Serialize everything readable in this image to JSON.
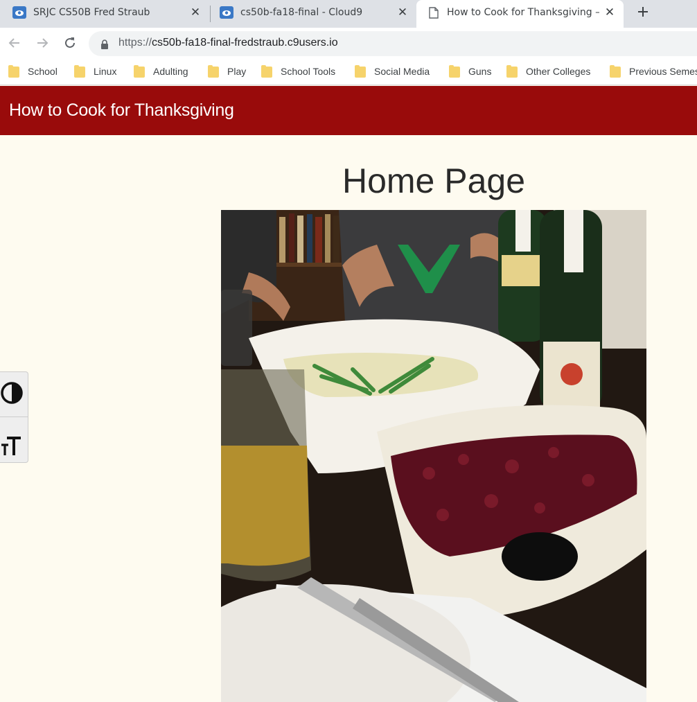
{
  "browser": {
    "tabs": [
      {
        "title": "SRJC CS50B Fred Straub",
        "icon": "cloud9-favicon",
        "active": false
      },
      {
        "title": "cs50b-fa18-final - Cloud9",
        "icon": "cloud9-favicon",
        "active": false
      },
      {
        "title": "How to Cook for Thanksgiving –",
        "icon": "page-icon",
        "active": true
      }
    ],
    "new_tab_icon": "plus-icon",
    "url_scheme": "https://",
    "url_rest": "cs50b-fa18-final-fredstraub.c9users.io",
    "bookmarks": [
      "School",
      "Linux",
      "Adulting",
      "Play",
      "School Tools",
      "Social Media",
      "Guns",
      "Other Colleges",
      "Previous Semes"
    ]
  },
  "site": {
    "title": "How to Cook for Thanksgiving",
    "heading": "Home Page",
    "photo_subject": "thanksgiving-table-photo",
    "header_color": "#990b0b",
    "background_color": "#fefbf0"
  },
  "accessibility": {
    "contrast_icon": "contrast-icon",
    "text_size_icon": "text-size-icon"
  }
}
